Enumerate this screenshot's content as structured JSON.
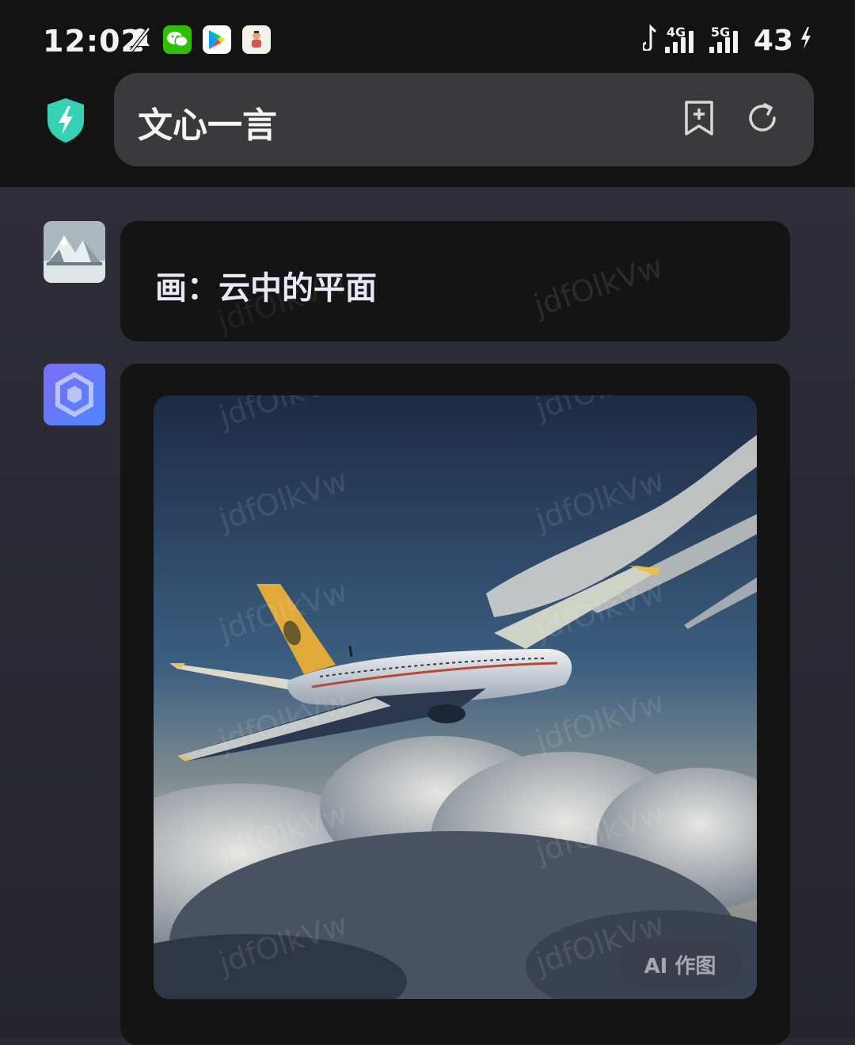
{
  "status_bar": {
    "time": "12:02",
    "battery": "43",
    "network_1": "4G",
    "network_2": "5G",
    "apps": [
      "wechat-icon",
      "play-store-icon",
      "app-avatar-icon"
    ]
  },
  "header": {
    "title": "文心一言"
  },
  "chat": {
    "user_message": "画：云中的平面",
    "watermark": "jdfOlkVw",
    "image_badge": "AI 作图"
  },
  "colors": {
    "accent_shield": "#36d1b5",
    "bot_avatar": "#6a7cff",
    "bubble_bg": "#141414"
  }
}
